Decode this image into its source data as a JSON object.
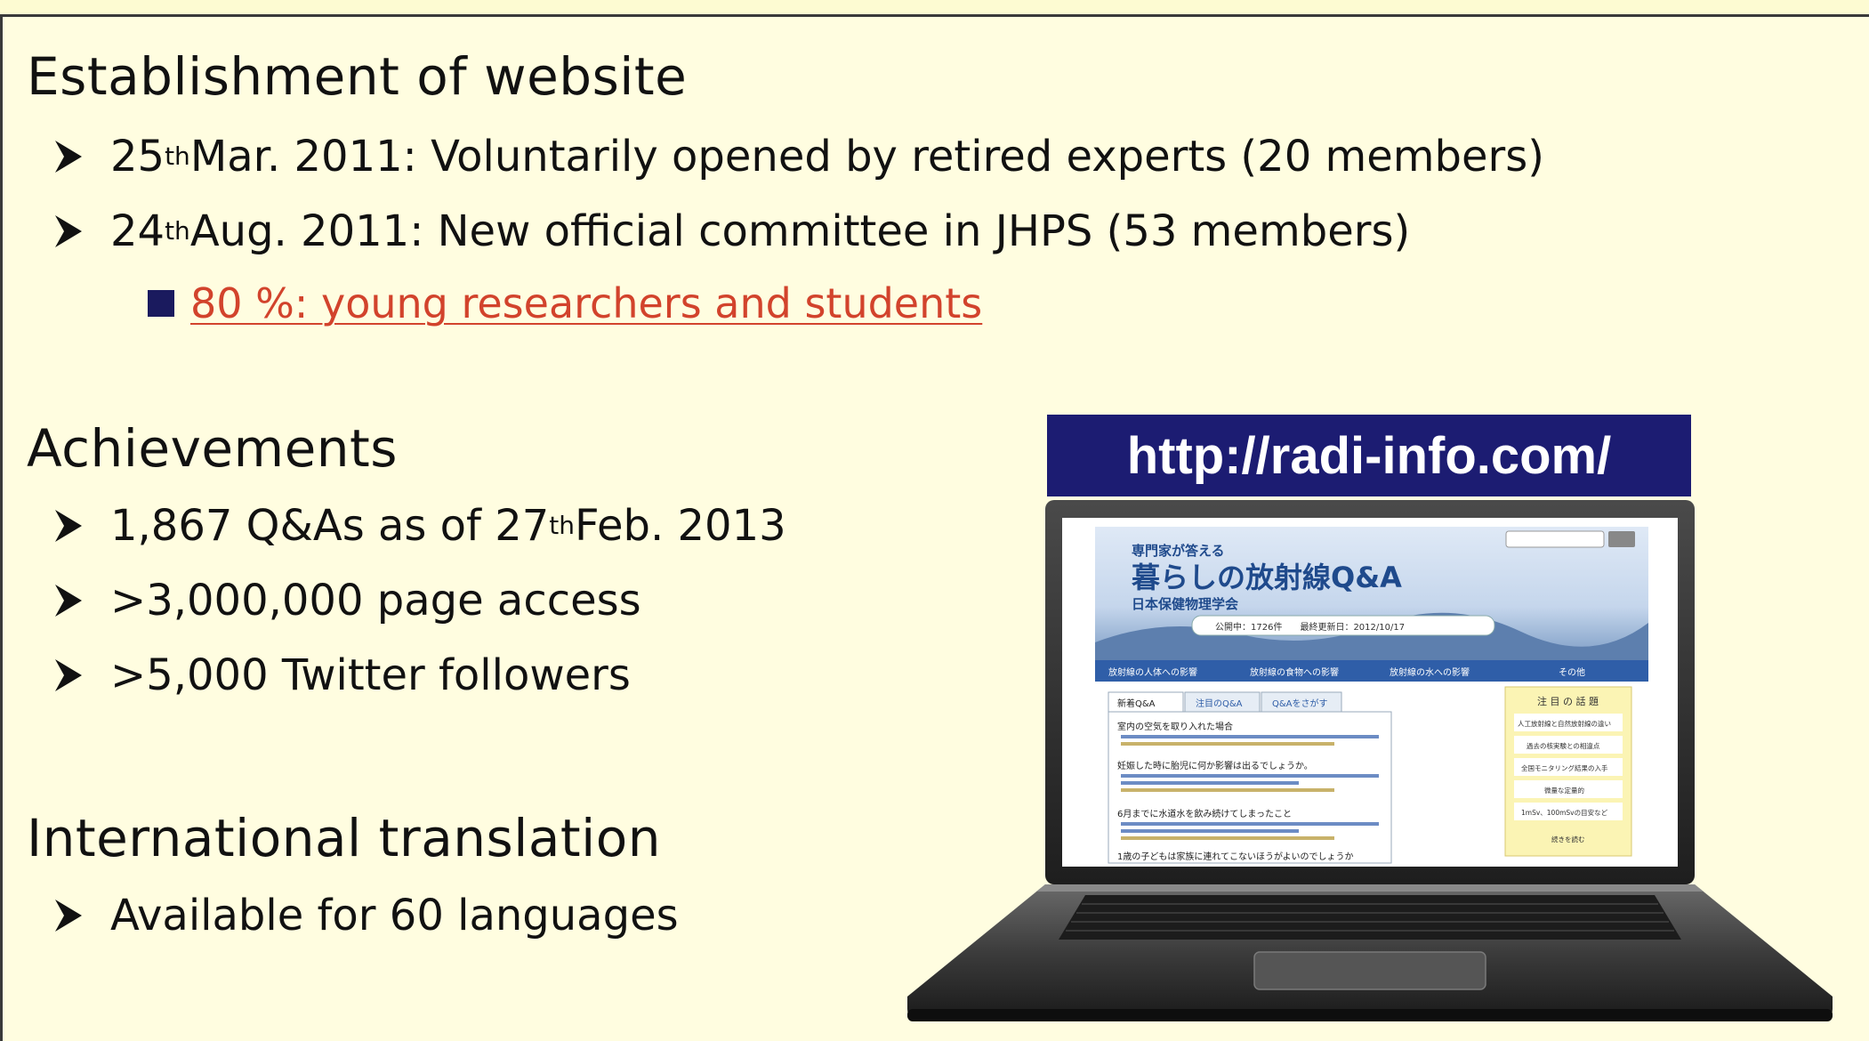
{
  "sections": [
    {
      "heading": "Establishment of website",
      "bullets": [
        {
          "pre": "25",
          "sup": "th",
          "post": " Mar. 2011: Voluntarily opened by retired experts (20 members)"
        },
        {
          "pre": "24",
          "sup": "th",
          "post": " Aug. 2011: New official committee in JHPS (53 members)"
        }
      ],
      "sub_bullet": "80 %: young researchers and students"
    },
    {
      "heading": "Achievements",
      "bullets": [
        {
          "pre": "1,867 Q&As as of 27",
          "sup": "th",
          "post": " Feb. 2013"
        },
        {
          "pre": ">3,000,000 page access",
          "sup": "",
          "post": ""
        },
        {
          "pre": ">5,000 Twitter followers",
          "sup": "",
          "post": ""
        }
      ]
    },
    {
      "heading": "International translation",
      "bullets": [
        {
          "pre": "Available for 60 languages",
          "sup": "",
          "post": ""
        }
      ]
    }
  ],
  "url_banner": "http://radi-info.com/",
  "screen": {
    "tagline": "専門家が答える",
    "site_title": "暮らしの放射線Q&A",
    "org": "日本保健物理学会",
    "stats": "公開中：1726件　　最終更新日：2012/10/17",
    "nav": [
      "放射線の人体への影響",
      "放射線の食物への影響",
      "放射線の水への影響",
      "その他"
    ],
    "tabs": [
      "新着Q&A",
      "注目のQ&A",
      "Q&Aをさがす"
    ],
    "side_title": "注 目 の 話 題",
    "side_items": [
      "人工放射線と自然放射線の違い",
      "過去の核実験との相違点",
      "全国モニタリング結果の入手",
      "微量な定量的",
      "1mSv、100mSvの目安など",
      "続きを読む"
    ],
    "questions": [
      "室内の空気を取り入れた場合",
      "妊娠した時に胎児に何か影響は出るでしょうか。",
      "6月までに水道水を飲み続けてしまったこと",
      "1歳の子どもは家族に連れてこないほうがよいのでしょうか"
    ],
    "colors": {
      "banner": "#1c1c72",
      "link": "#d2432c",
      "nav": "#2f5ea8"
    }
  }
}
